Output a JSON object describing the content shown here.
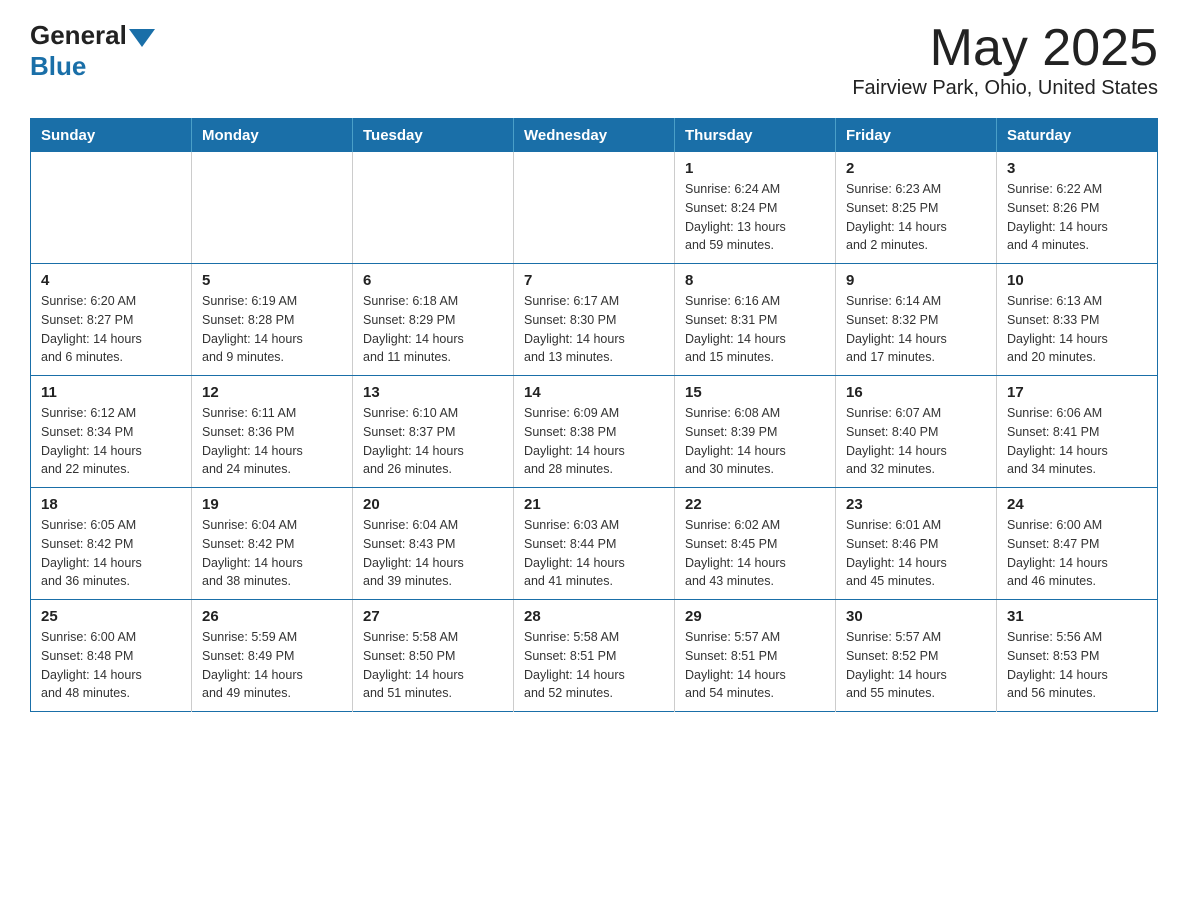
{
  "header": {
    "logo_general": "General",
    "logo_blue": "Blue",
    "title": "May 2025",
    "subtitle": "Fairview Park, Ohio, United States"
  },
  "calendar": {
    "days_of_week": [
      "Sunday",
      "Monday",
      "Tuesday",
      "Wednesday",
      "Thursday",
      "Friday",
      "Saturday"
    ],
    "weeks": [
      [
        {
          "day": "",
          "info": ""
        },
        {
          "day": "",
          "info": ""
        },
        {
          "day": "",
          "info": ""
        },
        {
          "day": "",
          "info": ""
        },
        {
          "day": "1",
          "info": "Sunrise: 6:24 AM\nSunset: 8:24 PM\nDaylight: 13 hours\nand 59 minutes."
        },
        {
          "day": "2",
          "info": "Sunrise: 6:23 AM\nSunset: 8:25 PM\nDaylight: 14 hours\nand 2 minutes."
        },
        {
          "day": "3",
          "info": "Sunrise: 6:22 AM\nSunset: 8:26 PM\nDaylight: 14 hours\nand 4 minutes."
        }
      ],
      [
        {
          "day": "4",
          "info": "Sunrise: 6:20 AM\nSunset: 8:27 PM\nDaylight: 14 hours\nand 6 minutes."
        },
        {
          "day": "5",
          "info": "Sunrise: 6:19 AM\nSunset: 8:28 PM\nDaylight: 14 hours\nand 9 minutes."
        },
        {
          "day": "6",
          "info": "Sunrise: 6:18 AM\nSunset: 8:29 PM\nDaylight: 14 hours\nand 11 minutes."
        },
        {
          "day": "7",
          "info": "Sunrise: 6:17 AM\nSunset: 8:30 PM\nDaylight: 14 hours\nand 13 minutes."
        },
        {
          "day": "8",
          "info": "Sunrise: 6:16 AM\nSunset: 8:31 PM\nDaylight: 14 hours\nand 15 minutes."
        },
        {
          "day": "9",
          "info": "Sunrise: 6:14 AM\nSunset: 8:32 PM\nDaylight: 14 hours\nand 17 minutes."
        },
        {
          "day": "10",
          "info": "Sunrise: 6:13 AM\nSunset: 8:33 PM\nDaylight: 14 hours\nand 20 minutes."
        }
      ],
      [
        {
          "day": "11",
          "info": "Sunrise: 6:12 AM\nSunset: 8:34 PM\nDaylight: 14 hours\nand 22 minutes."
        },
        {
          "day": "12",
          "info": "Sunrise: 6:11 AM\nSunset: 8:36 PM\nDaylight: 14 hours\nand 24 minutes."
        },
        {
          "day": "13",
          "info": "Sunrise: 6:10 AM\nSunset: 8:37 PM\nDaylight: 14 hours\nand 26 minutes."
        },
        {
          "day": "14",
          "info": "Sunrise: 6:09 AM\nSunset: 8:38 PM\nDaylight: 14 hours\nand 28 minutes."
        },
        {
          "day": "15",
          "info": "Sunrise: 6:08 AM\nSunset: 8:39 PM\nDaylight: 14 hours\nand 30 minutes."
        },
        {
          "day": "16",
          "info": "Sunrise: 6:07 AM\nSunset: 8:40 PM\nDaylight: 14 hours\nand 32 minutes."
        },
        {
          "day": "17",
          "info": "Sunrise: 6:06 AM\nSunset: 8:41 PM\nDaylight: 14 hours\nand 34 minutes."
        }
      ],
      [
        {
          "day": "18",
          "info": "Sunrise: 6:05 AM\nSunset: 8:42 PM\nDaylight: 14 hours\nand 36 minutes."
        },
        {
          "day": "19",
          "info": "Sunrise: 6:04 AM\nSunset: 8:42 PM\nDaylight: 14 hours\nand 38 minutes."
        },
        {
          "day": "20",
          "info": "Sunrise: 6:04 AM\nSunset: 8:43 PM\nDaylight: 14 hours\nand 39 minutes."
        },
        {
          "day": "21",
          "info": "Sunrise: 6:03 AM\nSunset: 8:44 PM\nDaylight: 14 hours\nand 41 minutes."
        },
        {
          "day": "22",
          "info": "Sunrise: 6:02 AM\nSunset: 8:45 PM\nDaylight: 14 hours\nand 43 minutes."
        },
        {
          "day": "23",
          "info": "Sunrise: 6:01 AM\nSunset: 8:46 PM\nDaylight: 14 hours\nand 45 minutes."
        },
        {
          "day": "24",
          "info": "Sunrise: 6:00 AM\nSunset: 8:47 PM\nDaylight: 14 hours\nand 46 minutes."
        }
      ],
      [
        {
          "day": "25",
          "info": "Sunrise: 6:00 AM\nSunset: 8:48 PM\nDaylight: 14 hours\nand 48 minutes."
        },
        {
          "day": "26",
          "info": "Sunrise: 5:59 AM\nSunset: 8:49 PM\nDaylight: 14 hours\nand 49 minutes."
        },
        {
          "day": "27",
          "info": "Sunrise: 5:58 AM\nSunset: 8:50 PM\nDaylight: 14 hours\nand 51 minutes."
        },
        {
          "day": "28",
          "info": "Sunrise: 5:58 AM\nSunset: 8:51 PM\nDaylight: 14 hours\nand 52 minutes."
        },
        {
          "day": "29",
          "info": "Sunrise: 5:57 AM\nSunset: 8:51 PM\nDaylight: 14 hours\nand 54 minutes."
        },
        {
          "day": "30",
          "info": "Sunrise: 5:57 AM\nSunset: 8:52 PM\nDaylight: 14 hours\nand 55 minutes."
        },
        {
          "day": "31",
          "info": "Sunrise: 5:56 AM\nSunset: 8:53 PM\nDaylight: 14 hours\nand 56 minutes."
        }
      ]
    ]
  }
}
